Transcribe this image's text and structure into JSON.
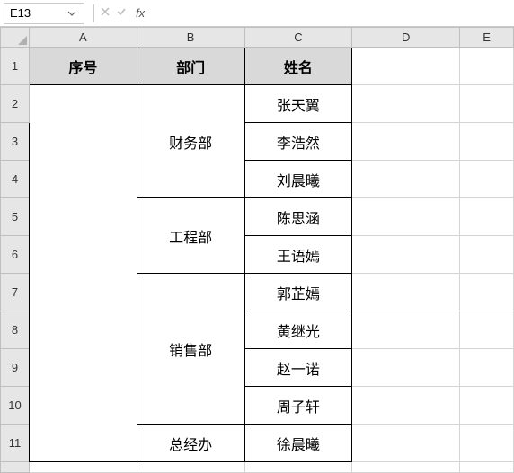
{
  "nameBox": {
    "value": "E13"
  },
  "formulaBar": {
    "value": ""
  },
  "fxLabel": "fx",
  "columns": [
    "A",
    "B",
    "C",
    "D",
    "E"
  ],
  "rows": [
    "1",
    "2",
    "3",
    "4",
    "5",
    "6",
    "7",
    "8",
    "9",
    "10",
    "11"
  ],
  "headers": {
    "a": "序号",
    "b": "部门",
    "c": "姓名"
  },
  "groups": [
    {
      "dept": "财务部",
      "names": [
        "张天翼",
        "李浩然",
        "刘晨曦"
      ]
    },
    {
      "dept": "工程部",
      "names": [
        "陈思涵",
        "王语嫣"
      ]
    },
    {
      "dept": "销售部",
      "names": [
        "郭芷嫣",
        "黄继光",
        "赵一诺",
        "周子轩"
      ]
    },
    {
      "dept": "总经办",
      "names": [
        "徐晨曦"
      ]
    }
  ]
}
